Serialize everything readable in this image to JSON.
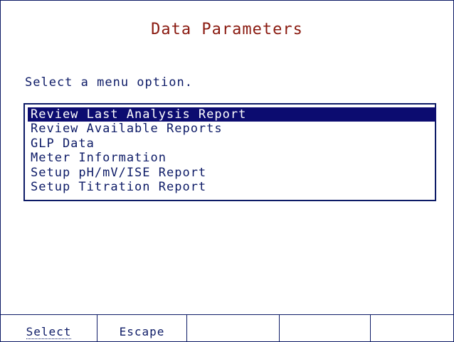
{
  "screen": {
    "title": "Data Parameters",
    "prompt": "Select a menu option."
  },
  "menu": {
    "selected_index": 0,
    "items": [
      {
        "label": "Review Last Analysis Report",
        "selected": true
      },
      {
        "label": "Review Available Reports",
        "selected": false
      },
      {
        "label": "GLP Data",
        "selected": false
      },
      {
        "label": "Meter Information",
        "selected": false
      },
      {
        "label": "Setup pH/mV/ISE Report",
        "selected": false
      },
      {
        "label": "Setup Titration Report",
        "selected": false
      }
    ]
  },
  "softkeys": [
    {
      "label": "Select"
    },
    {
      "label": "Escape"
    },
    {
      "label": ""
    },
    {
      "label": ""
    },
    {
      "label": ""
    }
  ],
  "colors": {
    "title": "#8a1a10",
    "text": "#0c1a66",
    "highlight": "#0c0c70",
    "background": "#ffffff"
  }
}
